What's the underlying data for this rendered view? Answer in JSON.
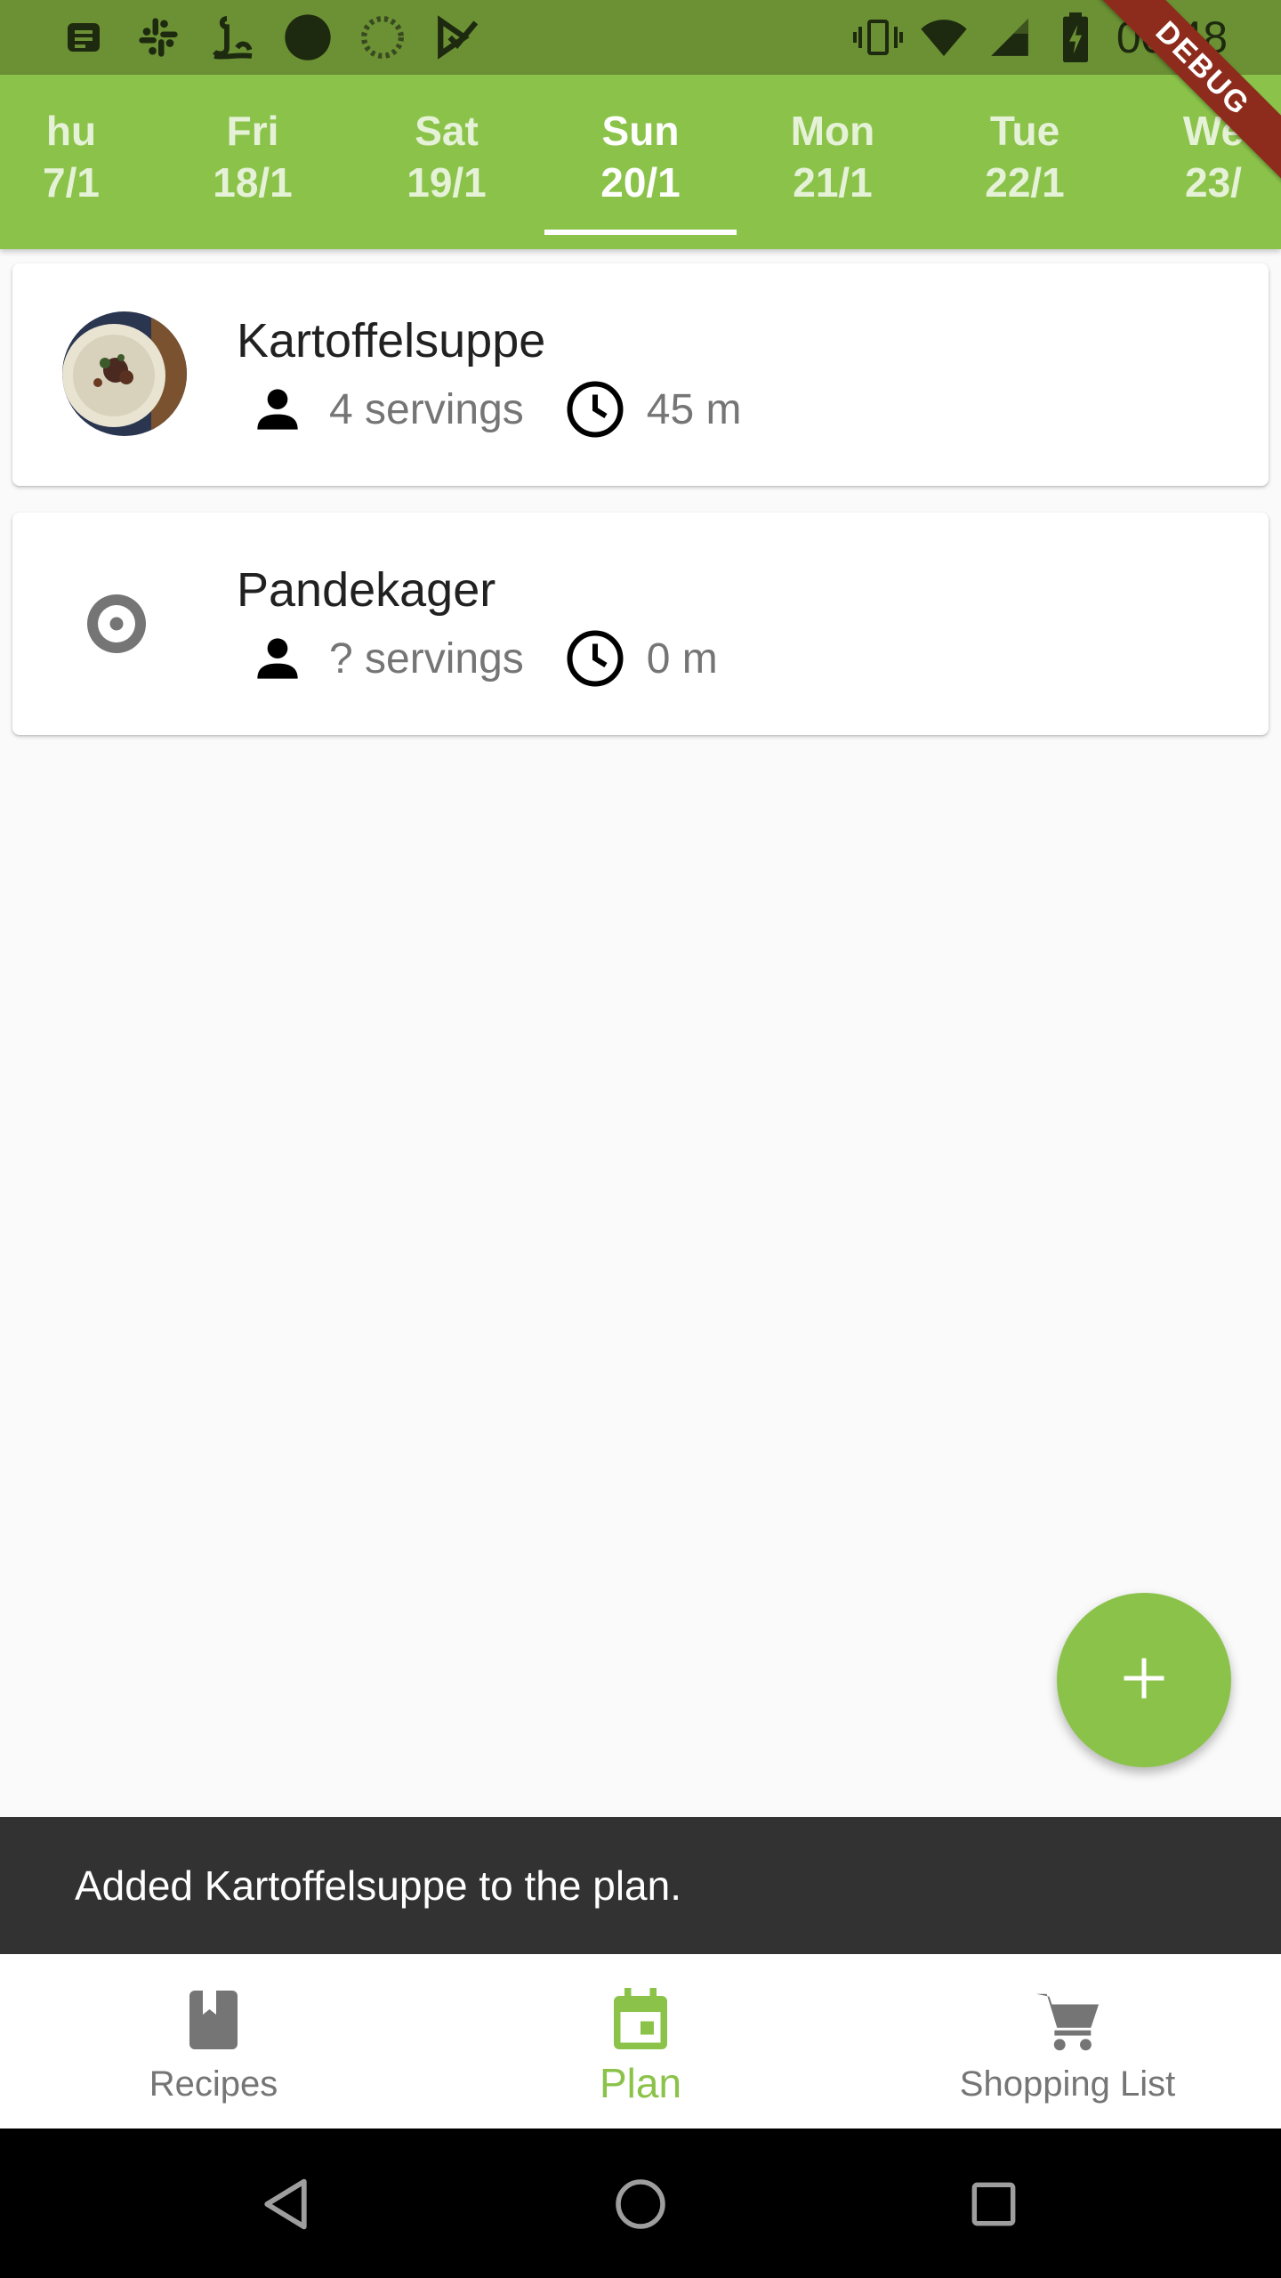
{
  "status_bar": {
    "time": "00:48",
    "left_icons": [
      "message-icon",
      "slack-icon",
      "app-icon",
      "circle-icon",
      "loading-icon",
      "check-icon"
    ],
    "right_icons": [
      "vibrate-icon",
      "wifi-icon",
      "signal-icon",
      "battery-icon"
    ]
  },
  "debug_banner": "DEBUG",
  "day_tabs": [
    {
      "day": "hu",
      "date": "7/1"
    },
    {
      "day": "Fri",
      "date": "18/1"
    },
    {
      "day": "Sat",
      "date": "19/1"
    },
    {
      "day": "Sun",
      "date": "20/1",
      "selected": true
    },
    {
      "day": "Mon",
      "date": "21/1"
    },
    {
      "day": "Tue",
      "date": "22/1"
    },
    {
      "day": "We",
      "date": "23/"
    }
  ],
  "meals": [
    {
      "title": "Kartoffelsuppe",
      "servings": "4 servings",
      "time": "45 m",
      "has_image": true
    },
    {
      "title": "Pandekager",
      "servings": "? servings",
      "time": "0 m",
      "has_image": false
    }
  ],
  "fab": {
    "icon": "add-icon"
  },
  "snackbar": {
    "message": "Added Kartoffelsuppe to the plan."
  },
  "bottom_nav": {
    "items": [
      {
        "label": "Recipes",
        "icon": "book-icon"
      },
      {
        "label": "Plan",
        "icon": "calendar-icon",
        "active": true
      },
      {
        "label": "Shopping List",
        "icon": "cart-icon"
      }
    ]
  },
  "colors": {
    "primary": "#8bc34a",
    "status_bar": "#6b9134",
    "snackbar": "#323232",
    "debug_ribbon": "#8d2c1c"
  }
}
